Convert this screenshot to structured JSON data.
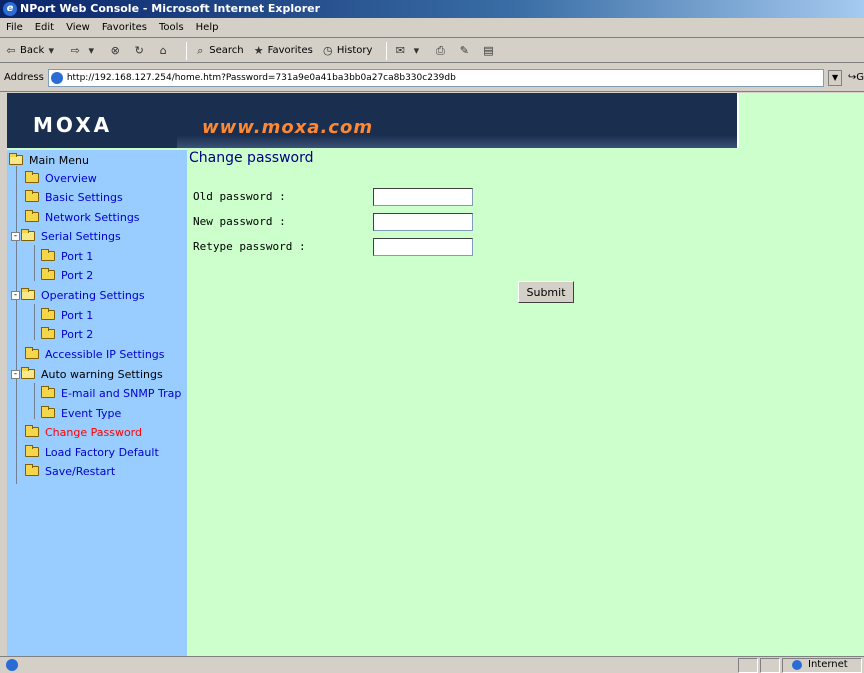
{
  "window": {
    "title": "NPort Web Console - Microsoft Internet Explorer"
  },
  "menubar": {
    "items": [
      "File",
      "Edit",
      "View",
      "Favorites",
      "Tools",
      "Help"
    ]
  },
  "toolbar": {
    "back_label": "Back",
    "search_label": "Search",
    "favorites_label": "Favorites",
    "history_label": "History"
  },
  "address": {
    "label": "Address",
    "url": "http://192.168.127.254/home.htm?Password=731a9e0a41ba3bb0a27ca8b330c239db",
    "go_label": "G"
  },
  "banner": {
    "logo": "MOXA",
    "url": "www.moxa.com"
  },
  "sidebar": {
    "items": [
      {
        "label": "Main Menu"
      },
      {
        "label": "Overview"
      },
      {
        "label": "Basic Settings"
      },
      {
        "label": "Network Settings"
      },
      {
        "label": "Serial Settings"
      },
      {
        "label": "Port 1"
      },
      {
        "label": "Port 2"
      },
      {
        "label": "Operating Settings"
      },
      {
        "label": "Port 1"
      },
      {
        "label": "Port 2"
      },
      {
        "label": "Accessible IP Settings"
      },
      {
        "label": "Auto warning Settings"
      },
      {
        "label": "E-mail and SNMP Trap"
      },
      {
        "label": "Event Type"
      },
      {
        "label": "Change Password"
      },
      {
        "label": "Load Factory Default"
      },
      {
        "label": "Save/Restart"
      }
    ]
  },
  "main": {
    "title": "Change password",
    "old_label": "Old password :",
    "new_label": "New password :",
    "retype_label": "Retype password :",
    "old_value": "",
    "new_value": "",
    "retype_value": "",
    "submit_label": "Submit"
  },
  "statusbar": {
    "zone": "Internet"
  },
  "colors": {
    "sidebar_bg": "#99ccff",
    "page_bg": "#ccffcc",
    "banner_bg": "#1a2e50",
    "link": "#0000cc",
    "active_link": "#ff0000",
    "url_accent": "#ff8833"
  }
}
